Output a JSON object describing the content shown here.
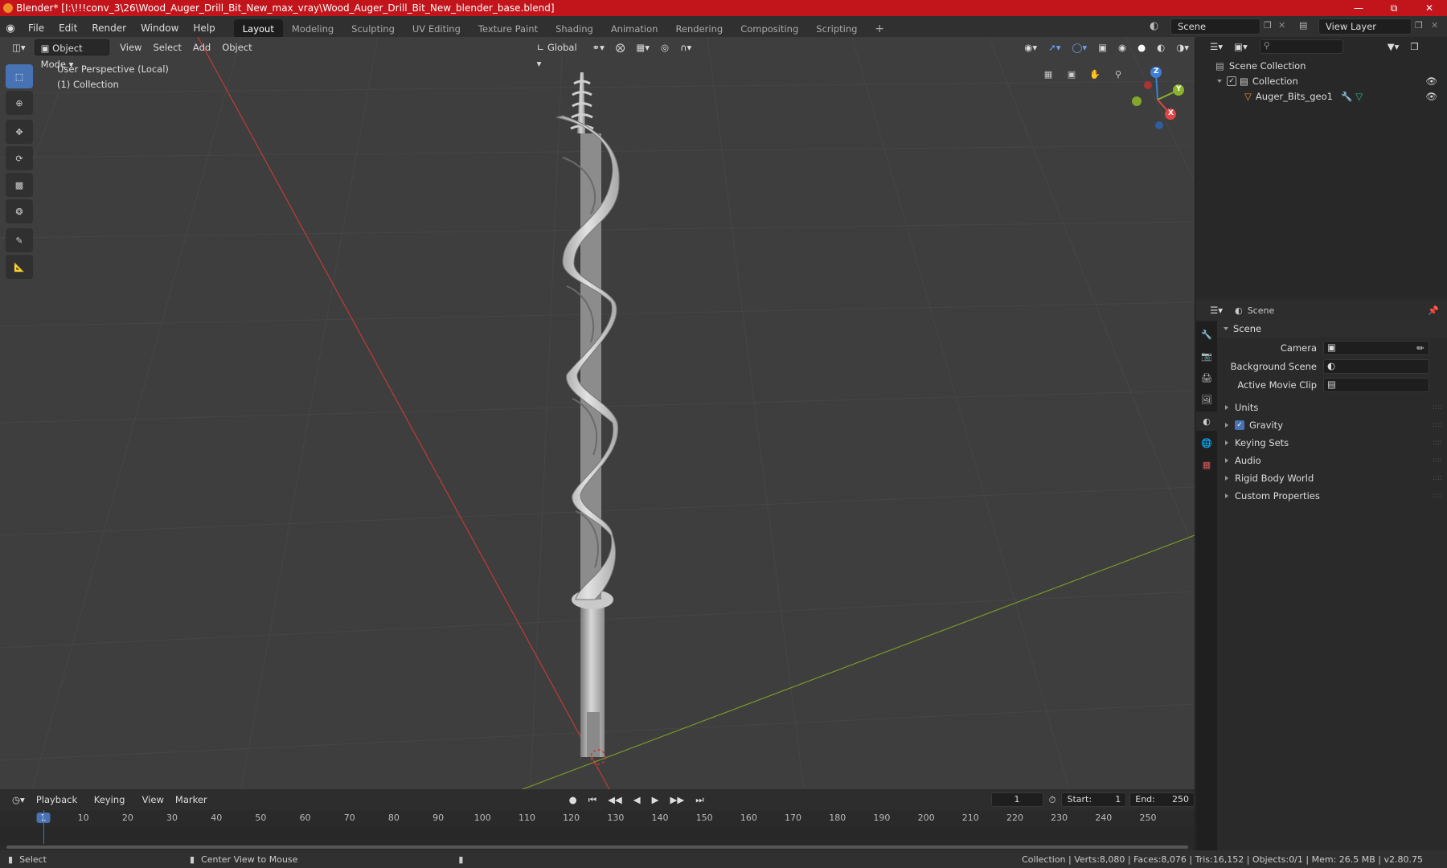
{
  "title": "Blender* [I:\\!!!conv_3\\26\\Wood_Auger_Drill_Bit_New_max_vray\\Wood_Auger_Drill_Bit_New_blender_base.blend]",
  "menu": [
    "File",
    "Edit",
    "Render",
    "Window",
    "Help"
  ],
  "workspaces": [
    "Layout",
    "Modeling",
    "Sculpting",
    "UV Editing",
    "Texture Paint",
    "Shading",
    "Animation",
    "Rendering",
    "Compositing",
    "Scripting"
  ],
  "scene_name": "Scene",
  "view_layer": "View Layer",
  "viewport": {
    "mode": "Object Mode",
    "menus": [
      "View",
      "Select",
      "Add",
      "Object"
    ],
    "orientation": "Global",
    "perspective": "User Perspective (Local)",
    "collection": "(1) Collection",
    "gizmo": {
      "x": "X",
      "y": "Y",
      "z": "Z"
    }
  },
  "outliner": {
    "root": "Scene Collection",
    "collection": "Collection",
    "object": "Auger_Bits_geo1"
  },
  "properties": {
    "header": "Scene",
    "panel": "Scene",
    "fields": {
      "camera": "Camera",
      "background_scene": "Background Scene",
      "active_movie_clip": "Active Movie Clip"
    },
    "sections": {
      "units": "Units",
      "gravity": "Gravity",
      "keying_sets": "Keying Sets",
      "audio": "Audio",
      "rigid_body": "Rigid Body World",
      "custom": "Custom Properties"
    }
  },
  "timeline": {
    "menus": [
      "Playback",
      "Keying",
      "View",
      "Marker"
    ],
    "current_frame": "1",
    "start_label": "Start:",
    "start": "1",
    "end_label": "End:",
    "end": "250",
    "ticks": [
      "1",
      "10",
      "20",
      "30",
      "40",
      "50",
      "60",
      "70",
      "80",
      "90",
      "100",
      "110",
      "120",
      "130",
      "140",
      "150",
      "160",
      "170",
      "180",
      "190",
      "200",
      "210",
      "220",
      "230",
      "240",
      "250"
    ]
  },
  "status": {
    "select": "Select",
    "center": "Center View to Mouse",
    "stats": "Collection | Verts:8,080 | Faces:8,076 | Tris:16,152 | Objects:0/1 | Mem: 26.5 MB | v2.80.75"
  },
  "colors": {
    "accent": "#4772b3",
    "title_bar": "#c2141b",
    "x_axis": "#e04545",
    "y_axis": "#8ab32a",
    "z_axis": "#3d7fd6"
  }
}
